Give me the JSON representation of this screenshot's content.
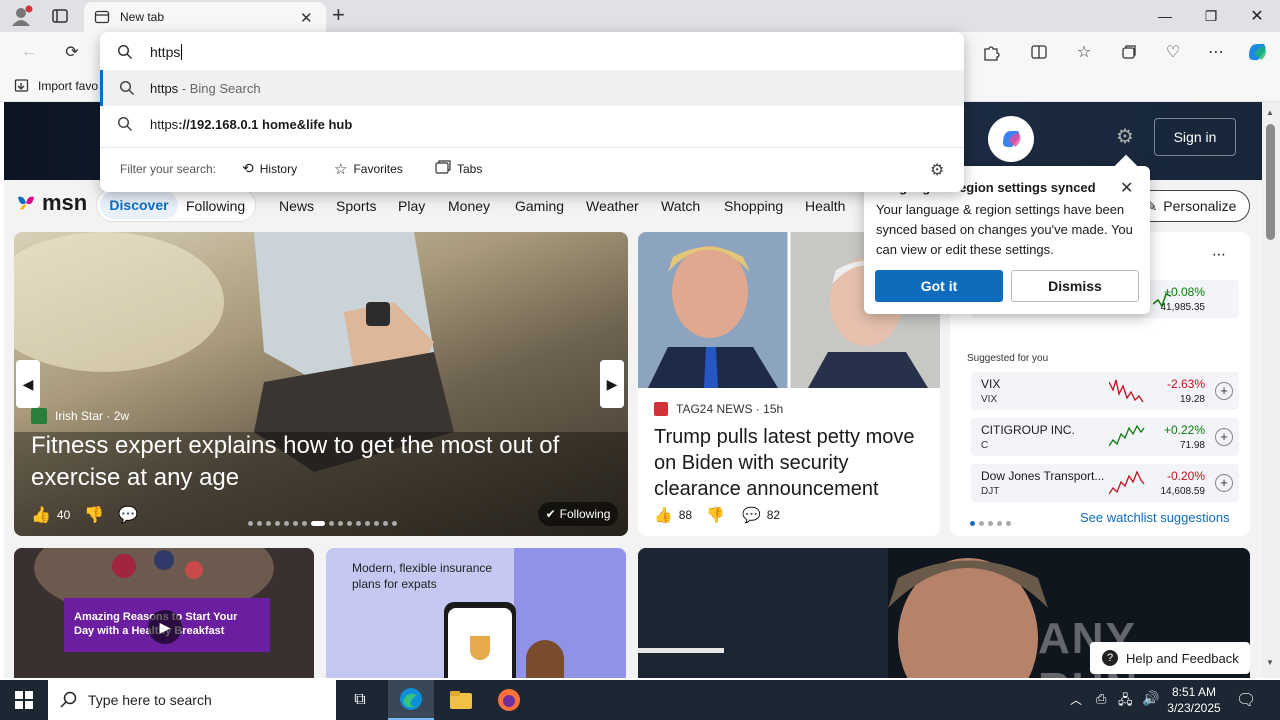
{
  "browser": {
    "tab_title": "New tab",
    "address_value": "https",
    "favorites_label": "Import favo",
    "sign_in": "Sign in"
  },
  "omnibox": {
    "suggestion1_main": "https",
    "suggestion1_sub": " - Bing Search",
    "suggestion2_prefix": "https",
    "suggestion2_rest": "://192.168.0.1 home&life hub",
    "filter_label": "Filter your search:",
    "filters": [
      "History",
      "Favorites",
      "Tabs"
    ]
  },
  "msn": {
    "logo": "msn",
    "nav": [
      "Discover",
      "Following",
      "News",
      "Sports",
      "Play",
      "Money",
      "Gaming",
      "Weather",
      "Watch",
      "Shopping",
      "Health"
    ],
    "personalize": "Personalize"
  },
  "hero_card": {
    "source": "Irish Star",
    "age": "2w",
    "headline": "Fitness expert explains how to get the most out of exercise at any age",
    "likes": "40",
    "following": "Following"
  },
  "news_card": {
    "source": "TAG24 NEWS",
    "age": "15h",
    "headline": "Trump pulls latest petty move on Biden with security clearance announcement",
    "likes": "88",
    "comments": "82"
  },
  "popup": {
    "title": "Language & region settings synced",
    "title_visible": "egion settings synced",
    "body": "Your language & region settings have been synced based on changes you've made. You can view or edit these settings.",
    "got_it": "Got it",
    "dismiss": "Dismiss"
  },
  "watchlist": {
    "top_change": "+0.08%",
    "top_value": "41,985.35",
    "suggested_label": "Suggested for you",
    "stocks": [
      {
        "name": "VIX",
        "symbol": "VIX",
        "change": "-2.63%",
        "value": "19.28",
        "trend": "neg"
      },
      {
        "name": "CITIGROUP INC.",
        "symbol": "C",
        "change": "+0.22%",
        "value": "71.98",
        "trend": "pos"
      },
      {
        "name": "Dow Jones Transport...",
        "symbol": "DJT",
        "change": "-0.20%",
        "value": "14,608.59",
        "trend": "neg"
      }
    ],
    "see_more": "See watchlist suggestions"
  },
  "bottom_cards": {
    "video_caption": "Amazing Reasons to Start Your Day with a Healthy Breakfast",
    "ad_text": "Modern, flexible insurance plans for expats",
    "watermark": "ANY RUN",
    "help": "Help and Feedback"
  },
  "taskbar": {
    "search_placeholder": "Type here to search",
    "time": "8:51 AM",
    "date": "3/23/2025"
  },
  "colors": {
    "accent": "#0f6cbd",
    "positive": "#0f7b0f",
    "negative": "#c50f1f"
  }
}
